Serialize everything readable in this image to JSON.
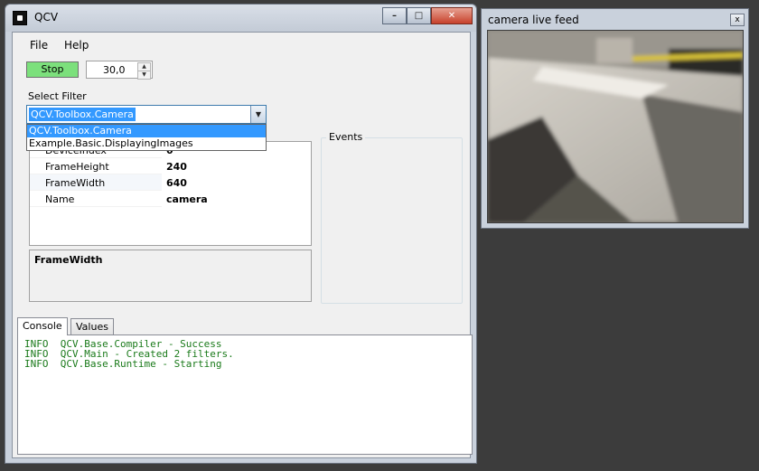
{
  "main_window": {
    "title": "QCV",
    "menu": [
      "File",
      "Help"
    ],
    "stop_label": "Stop",
    "fps_value": "30,0",
    "select_filter_label": "Select Filter",
    "filter_selected": "QCV.Toolbox.Camera",
    "filter_options": [
      "QCV.Toolbox.Camera",
      "Example.Basic.DisplayingImages"
    ],
    "properties": [
      {
        "name": "DeviceIndex",
        "value": "0"
      },
      {
        "name": "FrameHeight",
        "value": "240"
      },
      {
        "name": "FrameWidth",
        "value": "640"
      },
      {
        "name": "Name",
        "value": "camera"
      }
    ],
    "description_title": "FrameWidth",
    "events_label": "Events",
    "tabs": [
      "Console",
      "Values"
    ],
    "console_lines": [
      "INFO  QCV.Base.Compiler - Success",
      "INFO  QCV.Main - Created 2 filters.",
      "INFO  QCV.Base.Runtime - Starting"
    ]
  },
  "camera_window": {
    "title": "camera live feed",
    "close_glyph": "x"
  },
  "colors": {
    "stop_button": "#7ce07c",
    "console_text": "#1a7a1a",
    "selection": "#3399ff"
  }
}
